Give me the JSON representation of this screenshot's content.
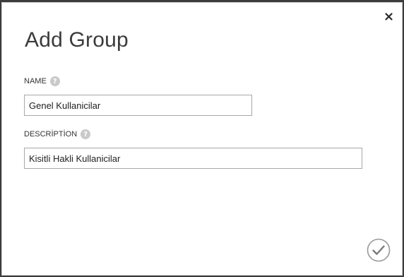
{
  "dialog": {
    "title": "Add Group",
    "close_icon": "close-icon",
    "confirm_icon": "checkmark-icon"
  },
  "fields": {
    "name": {
      "label": "NAME",
      "help_icon": "help-icon",
      "help_glyph": "?",
      "value": "Genel Kullanicilar"
    },
    "description": {
      "label": "DESCRİPTİON",
      "help_icon": "help-icon",
      "help_glyph": "?",
      "value": "Kisitli Hakli Kullanicilar"
    }
  },
  "colors": {
    "background": "#3c3c3c",
    "dialog": "#ffffff",
    "help_icon": "#c9c9c9",
    "field_border": "#a8a8a8"
  }
}
